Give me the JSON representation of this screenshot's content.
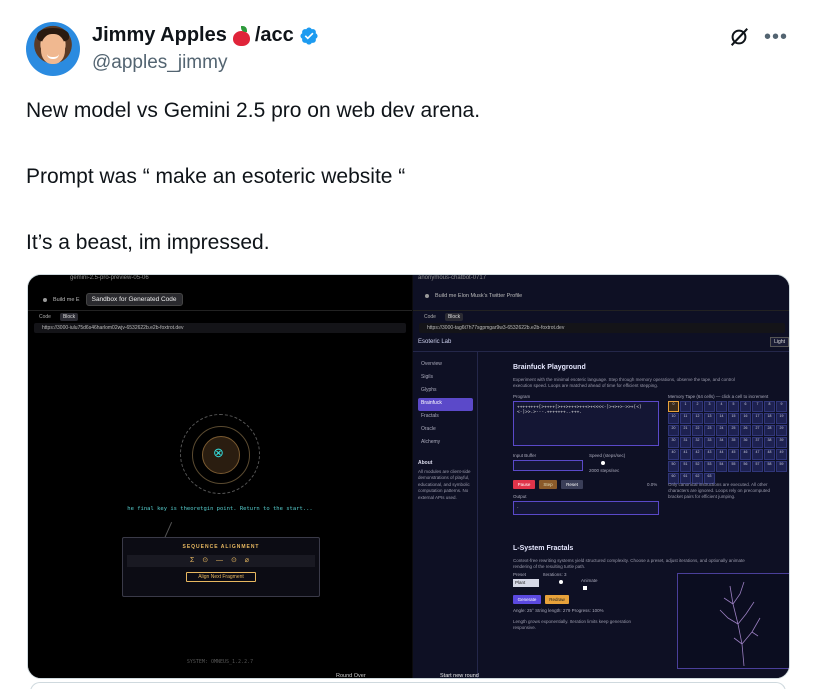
{
  "tweet": {
    "display_name": "Jimmy Apples",
    "name_suffix": "/acc",
    "handle": "@apples_jimmy",
    "lines": [
      "New model vs Gemini 2.5 pro on web dev arena.",
      "Prompt was “ make an esoteric website “",
      "It’s a beast, im impressed."
    ],
    "icons": {
      "verified": "verified-badge-icon",
      "grok": "grok-icon",
      "more": "more-icon",
      "apple": "apple-emoji-icon"
    },
    "colors": {
      "verified": "#1d9bf0",
      "text": "#0f1419",
      "muted": "#536471"
    }
  },
  "screenshot": {
    "left": {
      "model_label": "gemini-2.5-pro-preview-05-06",
      "prompt": "Build me Elon Musk’s Twitter Profile",
      "prompt_short": "Build me E",
      "tooltip": "Sandbox for Generated Code",
      "tabs": [
        "Code",
        "Block"
      ],
      "url": "https://3000-iulu75d6s46harlom02wjv-6532622b.e2b-foxtrot.dev",
      "final_key": "he final key is theoretgin point. Return to the start...",
      "sequence_title": "SEQUENCE ALIGNMENT",
      "sequence_symbols": "Σ ⊙ — ⊙ ⌀",
      "align_button": "Align Next Fragment",
      "system_line": "SYSTEM: OMNEUS_1.2.2.7",
      "round_over": "Round Over"
    },
    "right": {
      "model_label": "anonymous-chatbot-0717",
      "prompt": "Build me Elon Musk’s Twitter Profile",
      "tabs": [
        "Code",
        "Block"
      ],
      "url": "https://3000-tag6t7h77sgpmgar9w3-6532622b.e2b-foxtrot.dev",
      "lab_title": "Esoteric Lab",
      "light_button": "Light",
      "sidebar": [
        "Overview",
        "Sigils",
        "Glyphs",
        "Brainfuck",
        "Fractals",
        "Oracle",
        "Alchemy"
      ],
      "selected_index": 3,
      "about_title": "About",
      "about_text": "All modules are client-side demonstrations of playful, educational, and symbolic computation patterns. No external APIs used.",
      "bf_title": "Brainfuck Playground",
      "bf_desc": "Experiment with the minimal esoteric language. Step through memory operations, observe the tape, and control execution speed. Loops are matched ahead of time for efficient stepping.",
      "program_label": "Program",
      "program_text": "++++++++[>++++[>++>+++>+++>+<<<<-]>+>+>->>+[<]<-]>>.>---.+++++++..+++.",
      "input_label": "Input Buffer",
      "speed_label": "Speed (steps/sec)",
      "speed_value": "2000 steps/sec",
      "buttons": [
        "Pause",
        "Step",
        "Reset"
      ],
      "progress_pct": "0.0%",
      "output_label": "Output",
      "output_text": "·",
      "memory_label": "Memory Tape (64 cells) — click a cell to increment",
      "memory_cells": [
        "0",
        "1",
        "2",
        "3",
        "4",
        "5",
        "6",
        "7",
        "8",
        "9",
        "10",
        "11",
        "12",
        "13",
        "14",
        "15",
        "16",
        "17",
        "18",
        "19",
        "20",
        "21",
        "22",
        "23",
        "24",
        "25",
        "26",
        "27",
        "28",
        "29",
        "30",
        "31",
        "32",
        "33",
        "34",
        "35",
        "36",
        "37",
        "38",
        "39",
        "40",
        "41",
        "42",
        "43",
        "44",
        "45",
        "46",
        "47",
        "48",
        "49",
        "50",
        "51",
        "52",
        "53",
        "54",
        "55",
        "56",
        "57",
        "58",
        "59",
        "60",
        "61",
        "62",
        "63"
      ],
      "memory_note": "Only canonical instructions are executed. All other characters are ignored. Loops rely on precomputed bracket pairs for efficient jumping.",
      "lsys_title": "L-System Fractals",
      "lsys_desc": "Context-free rewriting systems yield structured complexity. Choose a preset, adjust iterations, and optionally animate rendering of the resulting turtle path.",
      "preset_label": "Preset",
      "preset_value": "Plant",
      "iter_label": "Iterations: 3",
      "animate_label": "Animate",
      "generate_button": "Generate",
      "redraw_button": "Redraw",
      "lsys_stats": "Angle: 25°   String length: 279   Progress: 100%",
      "lsys_note": "Length grows exponentially. Iteration limits keep generation responsive.",
      "start_round": "Start new round"
    }
  }
}
